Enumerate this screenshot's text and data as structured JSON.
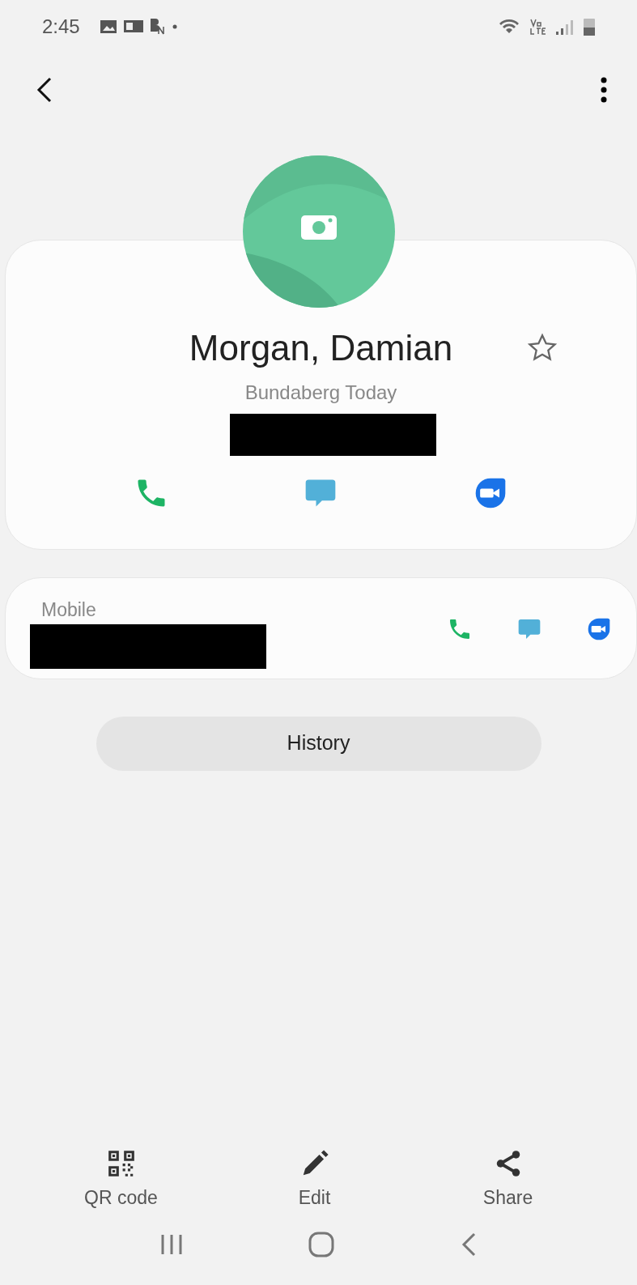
{
  "status_bar": {
    "time": "2:45"
  },
  "contact": {
    "name": "Morgan, Damian",
    "company": "Bundaberg Today",
    "favorite": false,
    "detail_redacted": true
  },
  "quick_actions": [
    {
      "kind": "call"
    },
    {
      "kind": "message"
    },
    {
      "kind": "video"
    }
  ],
  "phone": {
    "label": "Mobile",
    "redacted": true,
    "actions": [
      {
        "kind": "call"
      },
      {
        "kind": "message"
      },
      {
        "kind": "video"
      }
    ]
  },
  "history_button": "History",
  "bottom_actions": [
    {
      "kind": "qr",
      "label": "QR code"
    },
    {
      "kind": "edit",
      "label": "Edit"
    },
    {
      "kind": "share",
      "label": "Share"
    }
  ]
}
